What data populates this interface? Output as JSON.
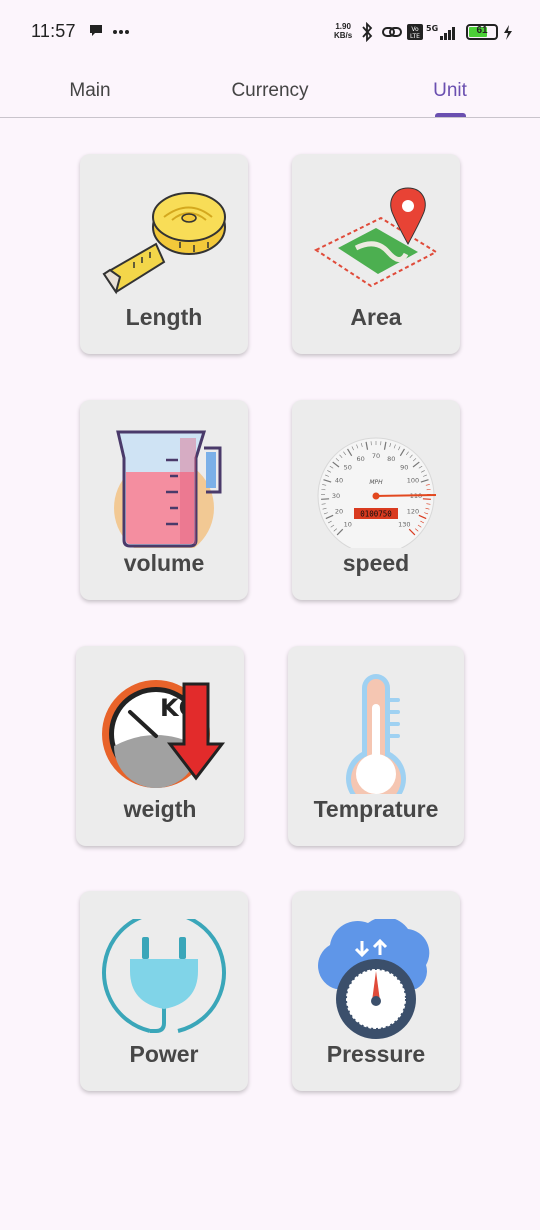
{
  "status_bar": {
    "time": "11:57",
    "net_speed_value": "1.90",
    "net_speed_unit": "KB/s",
    "battery": "61"
  },
  "tabs": [
    {
      "label": "Main",
      "active": false
    },
    {
      "label": "Currency",
      "active": false
    },
    {
      "label": "Unit",
      "active": true
    }
  ],
  "units": [
    {
      "label": "Length",
      "icon": "tape-measure-icon"
    },
    {
      "label": "Area",
      "icon": "map-pin-area-icon"
    },
    {
      "label": "volume",
      "icon": "measuring-jug-icon"
    },
    {
      "label": "speed",
      "icon": "speedometer-icon"
    },
    {
      "label": "weigth",
      "icon": "weight-scale-icon"
    },
    {
      "label": "Temprature",
      "icon": "thermometer-icon"
    },
    {
      "label": "Power",
      "icon": "power-plug-icon"
    },
    {
      "label": "Pressure",
      "icon": "pressure-gauge-icon"
    }
  ],
  "speedometer": {
    "unit_label": "MPH",
    "odometer": "0100750",
    "scale": [
      "10",
      "20",
      "30",
      "40",
      "50",
      "60",
      "70",
      "80",
      "90",
      "100",
      "110",
      "120",
      "130"
    ]
  },
  "weight_icon_text": "KG"
}
